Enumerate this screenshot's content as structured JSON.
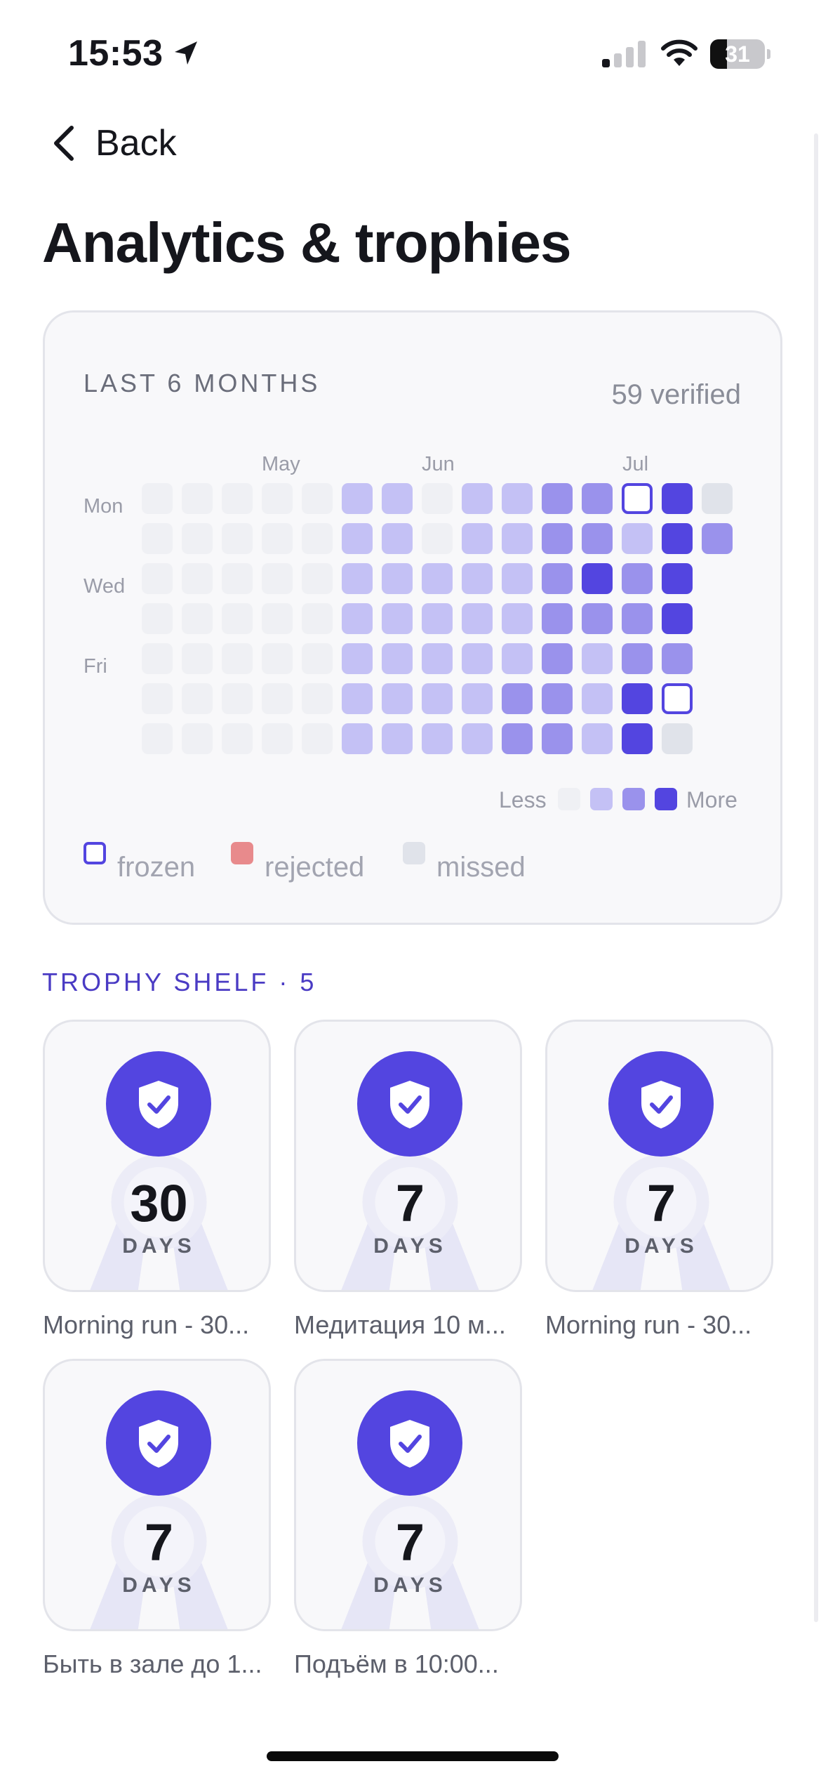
{
  "status_bar": {
    "time": "15:53",
    "battery": "31",
    "battery_level": 0.31
  },
  "nav": {
    "back_label": "Back"
  },
  "page_title": "Analytics & trophies",
  "analytics": {
    "heading": "LAST 6 MONTHS",
    "verified": "59 verified",
    "months": [
      "May",
      "Jun",
      "Jul"
    ],
    "day_labels": [
      "Mon",
      "Wed",
      "Fri"
    ],
    "legend_less": "Less",
    "legend_more": "More",
    "level_colors": [
      "#eff0f4",
      "#c4c1f5",
      "#9a92ec",
      "#5345e0"
    ],
    "frozen_color": "#5345e0",
    "rejected_color": "#e88a8c",
    "missed_color": "#e0e3ea",
    "key": {
      "frozen": "frozen",
      "rejected": "rejected",
      "missed": "missed"
    },
    "weeks": [
      [
        "0",
        "0",
        "0",
        "0",
        "0",
        "0",
        "0"
      ],
      [
        "0",
        "0",
        "0",
        "0",
        "0",
        "0",
        "0"
      ],
      [
        "0",
        "0",
        "0",
        "0",
        "0",
        "0",
        "0"
      ],
      [
        "0",
        "0",
        "0",
        "0",
        "0",
        "0",
        "0"
      ],
      [
        "0",
        "0",
        "0",
        "0",
        "0",
        "0",
        "0"
      ],
      [
        "1",
        "1",
        "1",
        "1",
        "1",
        "1",
        "1"
      ],
      [
        "1",
        "1",
        "1",
        "1",
        "1",
        "1",
        "1"
      ],
      [
        "0",
        "0",
        "1",
        "1",
        "1",
        "1",
        "1"
      ],
      [
        "1",
        "1",
        "1",
        "1",
        "1",
        "1",
        "1"
      ],
      [
        "1",
        "1",
        "1",
        "1",
        "1",
        "2",
        "2"
      ],
      [
        "2",
        "2",
        "2",
        "2",
        "2",
        "2",
        "2"
      ],
      [
        "2",
        "2",
        "3",
        "2",
        "1",
        "1",
        "1"
      ],
      [
        "frozen",
        "1",
        "2",
        "2",
        "2",
        "3",
        "3"
      ],
      [
        "3",
        "3",
        "3",
        "3",
        "2",
        "frozen",
        "missed"
      ],
      [
        "missed",
        "2",
        null,
        null,
        null,
        null,
        null
      ]
    ]
  },
  "shelf": {
    "title": "TROPHY SHELF · 5",
    "trophies": [
      {
        "number": "30",
        "unit": "DAYS",
        "name": "Morning run - 30..."
      },
      {
        "number": "7",
        "unit": "DAYS",
        "name": "Медитация 10 м..."
      },
      {
        "number": "7",
        "unit": "DAYS",
        "name": "Morning run - 30..."
      },
      {
        "number": "7",
        "unit": "DAYS",
        "name": "Быть в зале до 1..."
      },
      {
        "number": "7",
        "unit": "DAYS",
        "name": "Подъём в 10:00..."
      }
    ]
  },
  "icons": {
    "location": "location-arrow-icon",
    "signal": "cellular-signal-icon",
    "wifi": "wifi-icon",
    "back": "chevron-left-icon",
    "shield": "shield-check-icon"
  }
}
